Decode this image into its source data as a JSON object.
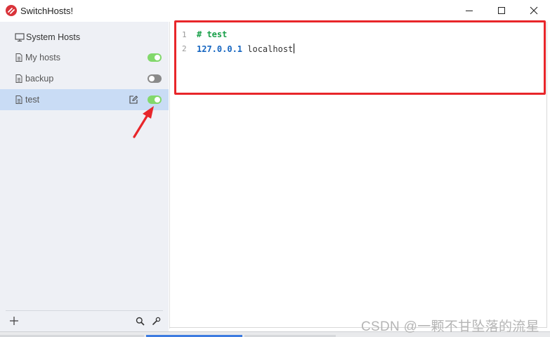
{
  "window": {
    "title": "SwitchHosts!"
  },
  "sidebar": {
    "system_item": {
      "label": "System Hosts",
      "icon": "monitor-icon"
    },
    "items": [
      {
        "label": "My hosts",
        "icon": "file-icon",
        "enabled": true
      },
      {
        "label": "backup",
        "icon": "file-icon",
        "enabled": false
      },
      {
        "label": "test",
        "icon": "file-icon",
        "enabled": true,
        "selected": true
      }
    ],
    "footer": {
      "add_icon": "plus-icon",
      "search_icon": "search-icon",
      "tools_icon": "wrench-icon"
    }
  },
  "editor": {
    "lines": [
      {
        "number": "1",
        "comment": "# test"
      },
      {
        "number": "2",
        "ip": "127.0.0.1",
        "host": " localhost"
      }
    ]
  },
  "watermark": "CSDN @一颗不甘坠落的流星",
  "colors": {
    "toggle_on": "#82d86b",
    "toggle_off": "#8a8a8a",
    "selected_row": "#c9dcf5",
    "annotation": "#e8262a",
    "comment": "#1aa04a",
    "ip": "#1565c0"
  }
}
